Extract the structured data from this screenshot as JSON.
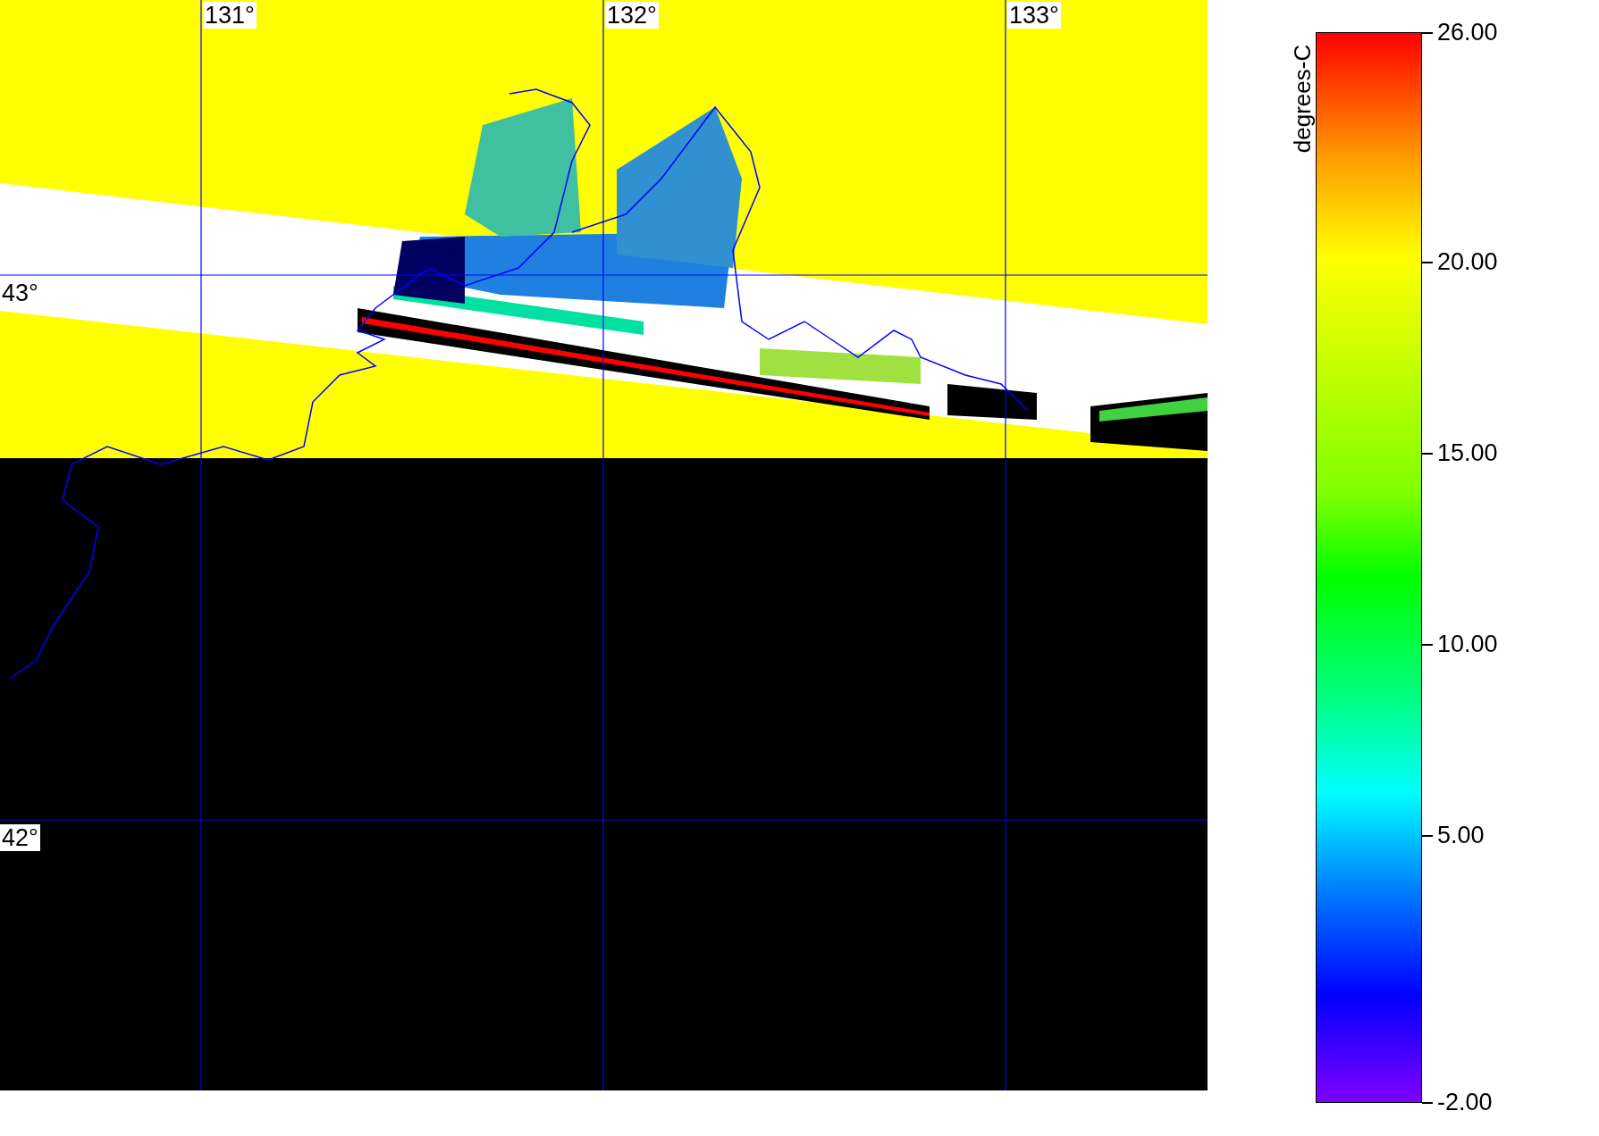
{
  "map": {
    "longitude_labels": [
      "131°",
      "132°",
      "133°"
    ],
    "latitude_labels": [
      "43°",
      "42°"
    ]
  },
  "colorbar": {
    "title": "degrees-C",
    "tick_labels": [
      "26.00",
      "20.00",
      "15.00",
      "10.00",
      "5.00",
      "-2.00"
    ]
  }
}
